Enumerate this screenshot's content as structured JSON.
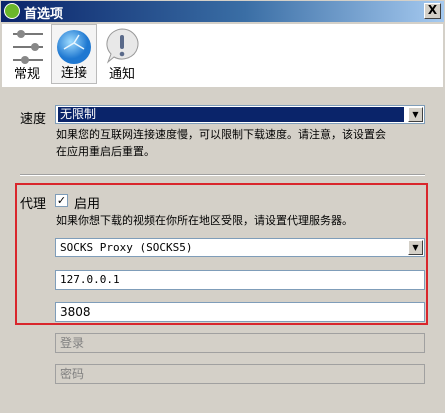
{
  "window": {
    "title": "首选项",
    "close_label": "X"
  },
  "tabs": [
    {
      "label": "常规",
      "icon": "sliders-icon"
    },
    {
      "label": "连接",
      "icon": "globe-icon",
      "selected": true
    },
    {
      "label": "通知",
      "icon": "exclamation-bubble-icon"
    }
  ],
  "speed": {
    "label": "速度",
    "value": "无限制",
    "description_line1": "如果您的互联网连接速度慢，可以限制下载速度。请注意，该设置会",
    "description_line2": "在应用重启后重置。"
  },
  "proxy": {
    "label": "代理",
    "enable_label": "启用",
    "enabled": true,
    "description": "如果你想下载的视频在你所在地区受限，请设置代理服务器。",
    "type": "SOCKS Proxy (SOCKS5)",
    "host": "127.0.0.1",
    "port": "3808",
    "login_placeholder": "登录",
    "password_placeholder": "密码"
  },
  "colors": {
    "highlight": "#0a246a",
    "proxy_box_border": "#d9262c"
  }
}
